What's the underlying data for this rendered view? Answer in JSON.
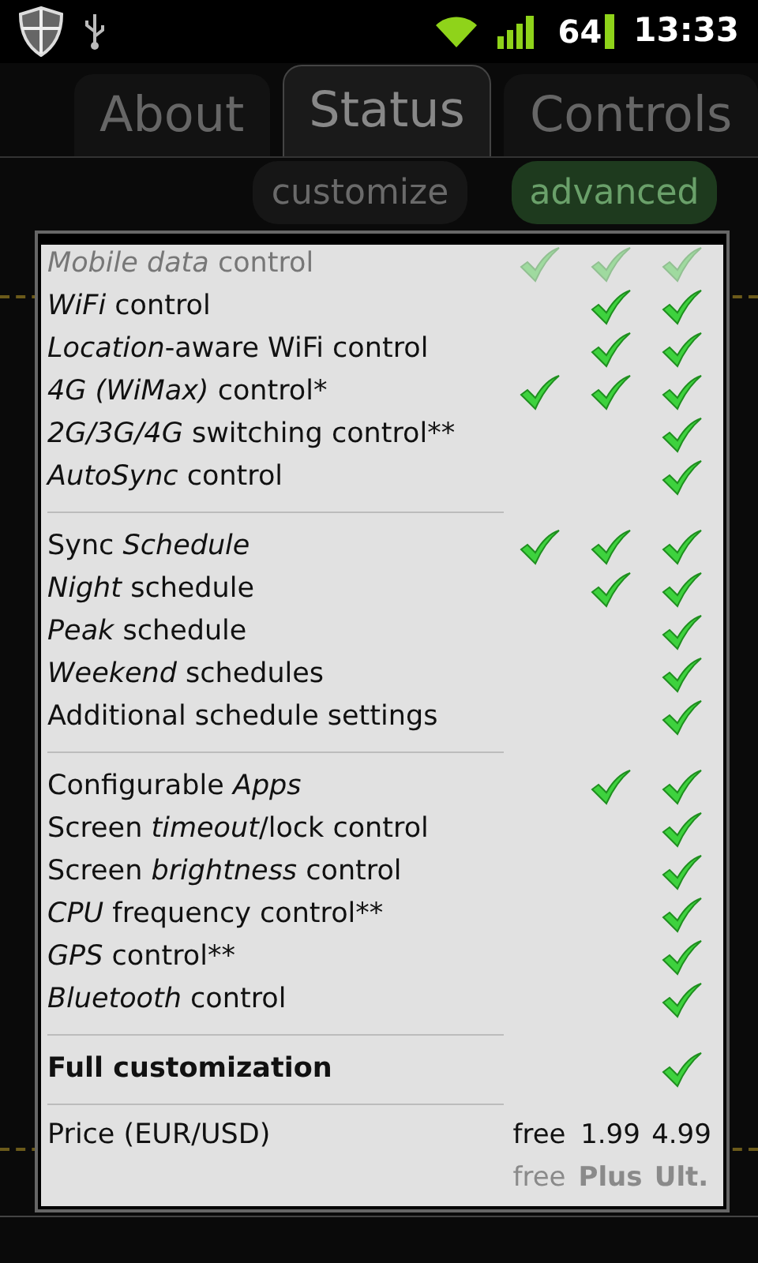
{
  "status_bar": {
    "battery": "64",
    "time": "13:33"
  },
  "tabs": [
    {
      "label": "About",
      "selected": false
    },
    {
      "label": "Status",
      "selected": true
    },
    {
      "label": "Controls",
      "selected": false
    }
  ],
  "buttons": [
    {
      "label": "customize",
      "selected": false
    },
    {
      "label": "advanced",
      "selected": true
    }
  ],
  "dialog": {
    "groups": [
      {
        "rows": [
          {
            "label": "*Mobile data* control",
            "faded": true,
            "checks": [
              true,
              true,
              true
            ]
          },
          {
            "label": "*WiFi* control",
            "faded": false,
            "checks": [
              false,
              true,
              true
            ]
          },
          {
            "label": "*Location*-aware WiFi control",
            "faded": false,
            "checks": [
              false,
              true,
              true
            ]
          },
          {
            "label": "*4G (WiMax)* control*",
            "faded": false,
            "checks": [
              true,
              true,
              true
            ]
          },
          {
            "label": "*2G/3G/4G* switching control**",
            "faded": false,
            "checks": [
              false,
              false,
              true
            ]
          },
          {
            "label": "*AutoSync* control",
            "faded": false,
            "checks": [
              false,
              false,
              true
            ]
          }
        ]
      },
      {
        "rows": [
          {
            "label": "Sync *Schedule*",
            "faded": false,
            "checks": [
              true,
              true,
              true
            ]
          },
          {
            "label": "*Night* schedule",
            "faded": false,
            "checks": [
              false,
              true,
              true
            ]
          },
          {
            "label": "*Peak* schedule",
            "faded": false,
            "checks": [
              false,
              false,
              true
            ]
          },
          {
            "label": "*Weekend* schedules",
            "faded": false,
            "checks": [
              false,
              false,
              true
            ]
          },
          {
            "label": "Additional schedule settings",
            "faded": false,
            "checks": [
              false,
              false,
              true
            ]
          }
        ]
      },
      {
        "rows": [
          {
            "label": "Configurable *Apps*",
            "faded": false,
            "checks": [
              false,
              true,
              true
            ]
          },
          {
            "label": "Screen *timeout*/lock control",
            "faded": false,
            "checks": [
              false,
              false,
              true
            ]
          },
          {
            "label": "Screen *brightness* control",
            "faded": false,
            "checks": [
              false,
              false,
              true
            ]
          },
          {
            "label": "*CPU* frequency control**",
            "faded": false,
            "checks": [
              false,
              false,
              true
            ]
          },
          {
            "label": "*GPS* control**",
            "faded": false,
            "checks": [
              false,
              false,
              true
            ]
          },
          {
            "label": "*Bluetooth* control",
            "faded": false,
            "checks": [
              false,
              false,
              true
            ]
          }
        ]
      },
      {
        "rows": [
          {
            "label": "Full customization",
            "bold": true,
            "faded": false,
            "checks": [
              false,
              false,
              true
            ]
          }
        ]
      }
    ],
    "price": {
      "label": "Price (EUR/USD)",
      "values": [
        "free",
        "1.99",
        "4.99"
      ]
    },
    "tiers": [
      {
        "label": "free",
        "bold": false
      },
      {
        "label": "Plus",
        "bold": true
      },
      {
        "label": "Ult.",
        "bold": true
      }
    ]
  }
}
